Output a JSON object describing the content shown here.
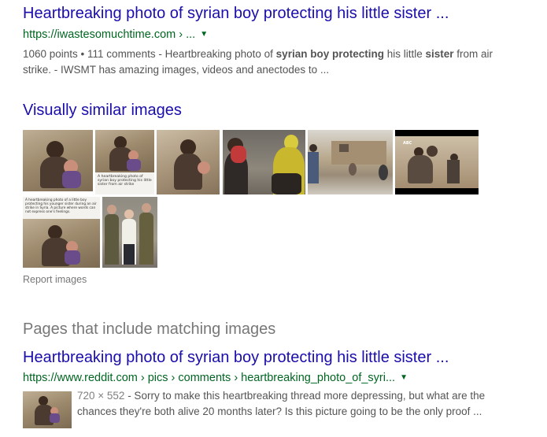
{
  "result1": {
    "title": "Heartbreaking photo of syrian boy protecting his little sister ...",
    "url": "https://iwastesomuchtime.com › ...",
    "snippet": {
      "part1": "1060 points • 111 comments - Heartbreaking photo of ",
      "bold1": "syrian boy protecting",
      "part2": " his little ",
      "bold2": "sister",
      "part3": " from air strike. - IWSMT has amazing images, videos and anectodes to ..."
    }
  },
  "similar": {
    "title": "Visually similar images",
    "thumbs": [
      {
        "name": "similar-image-1"
      },
      {
        "name": "similar-image-2",
        "caption": "A heartbreaking photo of syrian boy protecting his little sister from air strike"
      },
      {
        "name": "similar-image-3"
      },
      {
        "name": "similar-image-4"
      },
      {
        "name": "similar-image-5"
      },
      {
        "name": "similar-image-6"
      },
      {
        "name": "similar-image-7"
      },
      {
        "name": "similar-image-8",
        "caption": "A heartbreaking photo of a little boy protecting his younger sister during an air strike in Syria. A picture where words can not express one's feelings."
      },
      {
        "name": "similar-image-9"
      }
    ],
    "report": "Report images"
  },
  "pages": {
    "title": "Pages that include matching images"
  },
  "result2": {
    "title": "Heartbreaking photo of syrian boy protecting his little sister ...",
    "url": "https://www.reddit.com › pics › comments › heartbreaking_photo_of_syri...",
    "size": "720 × 552",
    "snippet": " - Sorry to make this heartbreaking thread more depressing, but what are the chances they're both alive 20 months later? Is this picture going to be the only proof ..."
  },
  "colors": {
    "link": "#1a0dab",
    "url_green": "#006621",
    "snippet_gray": "#545454",
    "muted_gray": "#777777"
  }
}
